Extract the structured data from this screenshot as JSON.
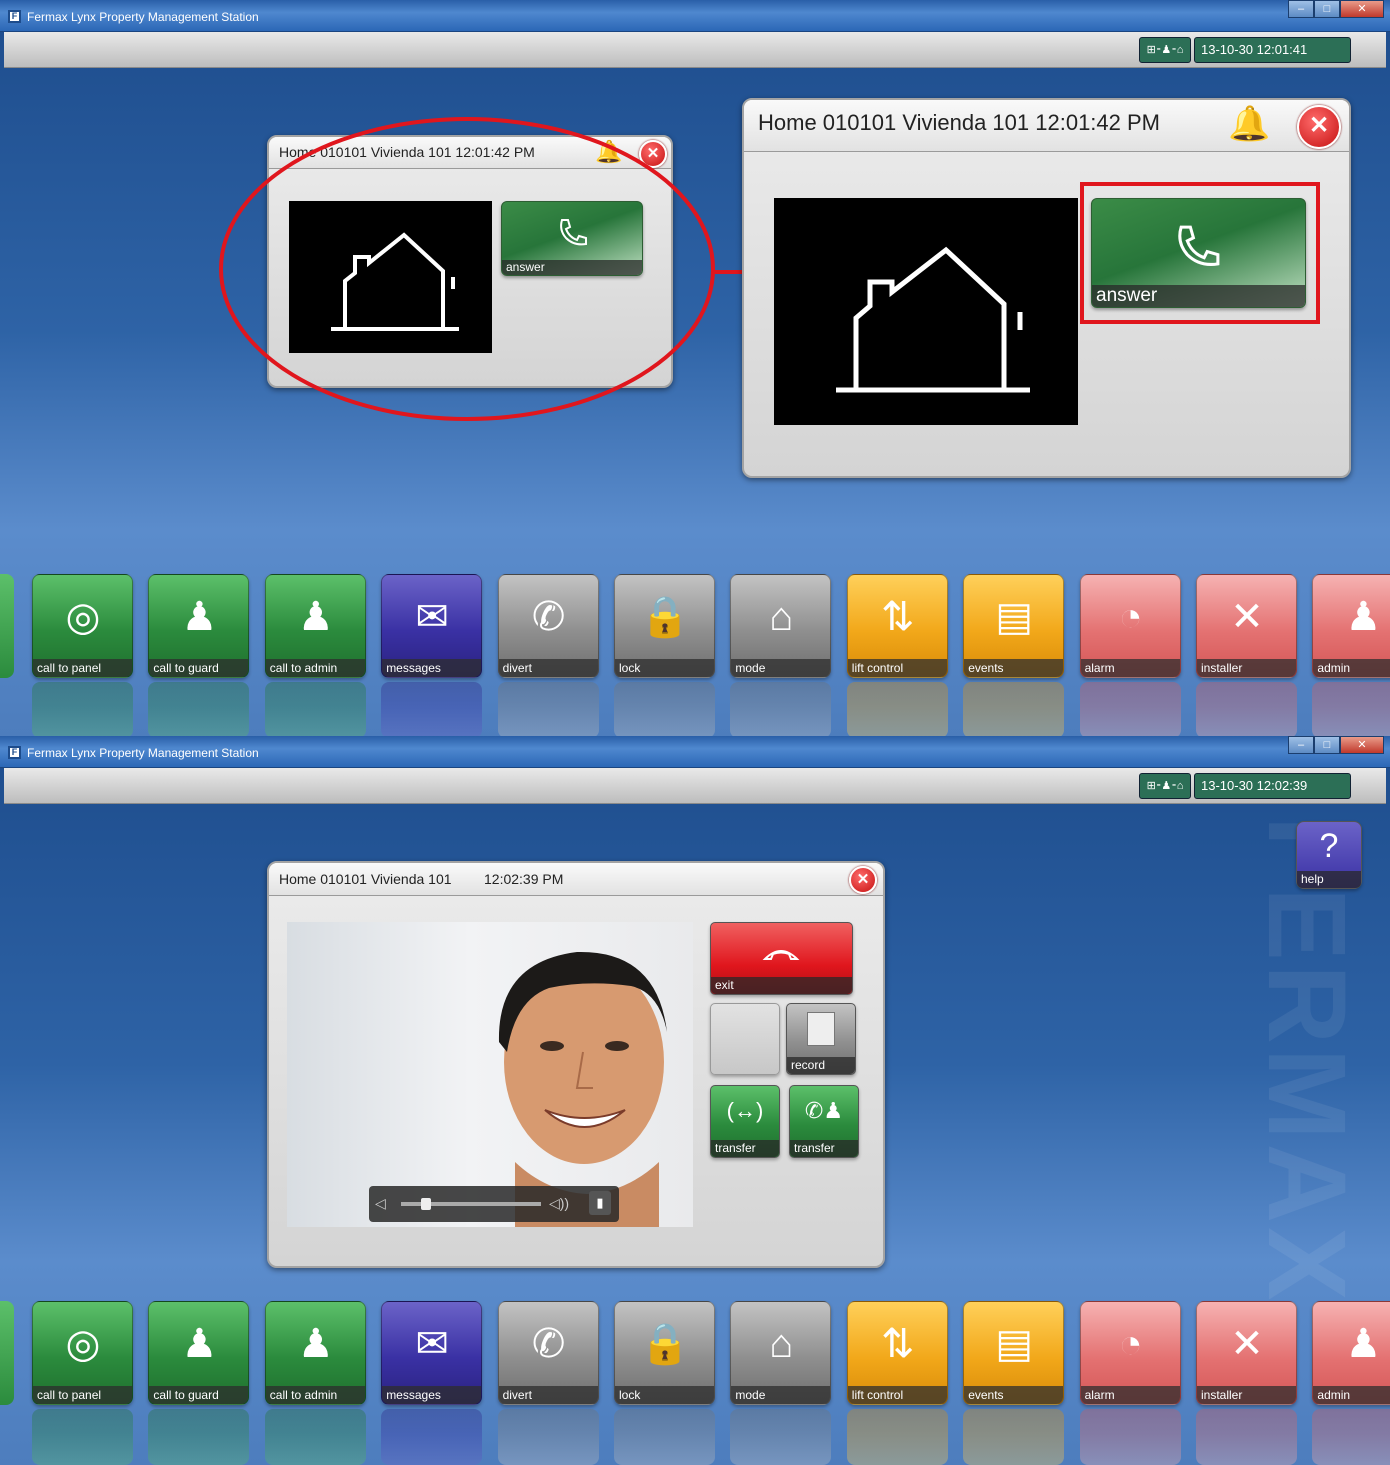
{
  "window": {
    "title": "Fermax Lynx Property Management Station",
    "minimize": "–",
    "maximize": "□",
    "close": "✕"
  },
  "screen1": {
    "status_icon": "⊞⁃♟⁃⌂",
    "datetime": "13-10-30 12:01:41",
    "call_popup_small": {
      "title": "Home 010101 Vivienda 101 12:01:42 PM",
      "answer_label": "answer"
    },
    "call_popup_zoom": {
      "title": "Home 010101 Vivienda 101 12:01:42 PM",
      "answer_label": "answer"
    }
  },
  "screen2": {
    "status_icon": "⊞⁃♟⁃⌂",
    "datetime": "13-10-30 12:02:39",
    "help_label": "help",
    "call_window": {
      "title": "Home 010101 Vivienda 101",
      "time": "12:02:39 PM",
      "exit_label": "exit",
      "record_label": "record",
      "transfer1_label": "transfer",
      "transfer2_label": "transfer"
    },
    "volume_level": 0.18
  },
  "dock": {
    "items": [
      {
        "label": "call to panel",
        "icon": "panel-icon",
        "color": "green"
      },
      {
        "label": "call to guard",
        "icon": "guard-icon",
        "color": "green"
      },
      {
        "label": "call to admin",
        "icon": "admin-person-icon",
        "color": "green"
      },
      {
        "label": "messages",
        "icon": "envelope-icon",
        "color": "blue"
      },
      {
        "label": "divert",
        "icon": "divert-phone-icon",
        "color": "gray"
      },
      {
        "label": "lock",
        "icon": "padlock-icon",
        "color": "gray"
      },
      {
        "label": "mode",
        "icon": "house-gear-icon",
        "color": "gray"
      },
      {
        "label": "lift control",
        "icon": "lift-icon",
        "color": "yellow"
      },
      {
        "label": "events",
        "icon": "documents-icon",
        "color": "yellow"
      },
      {
        "label": "alarm",
        "icon": "alarm-bell-icon",
        "color": "red"
      },
      {
        "label": "installer",
        "icon": "tools-icon",
        "color": "red"
      },
      {
        "label": "admin",
        "icon": "admin-icon",
        "color": "red"
      }
    ]
  },
  "colors": {
    "accent_red": "#e0161d",
    "answer_green": "#2b8b3d",
    "background_blue": "#2e63a6"
  }
}
